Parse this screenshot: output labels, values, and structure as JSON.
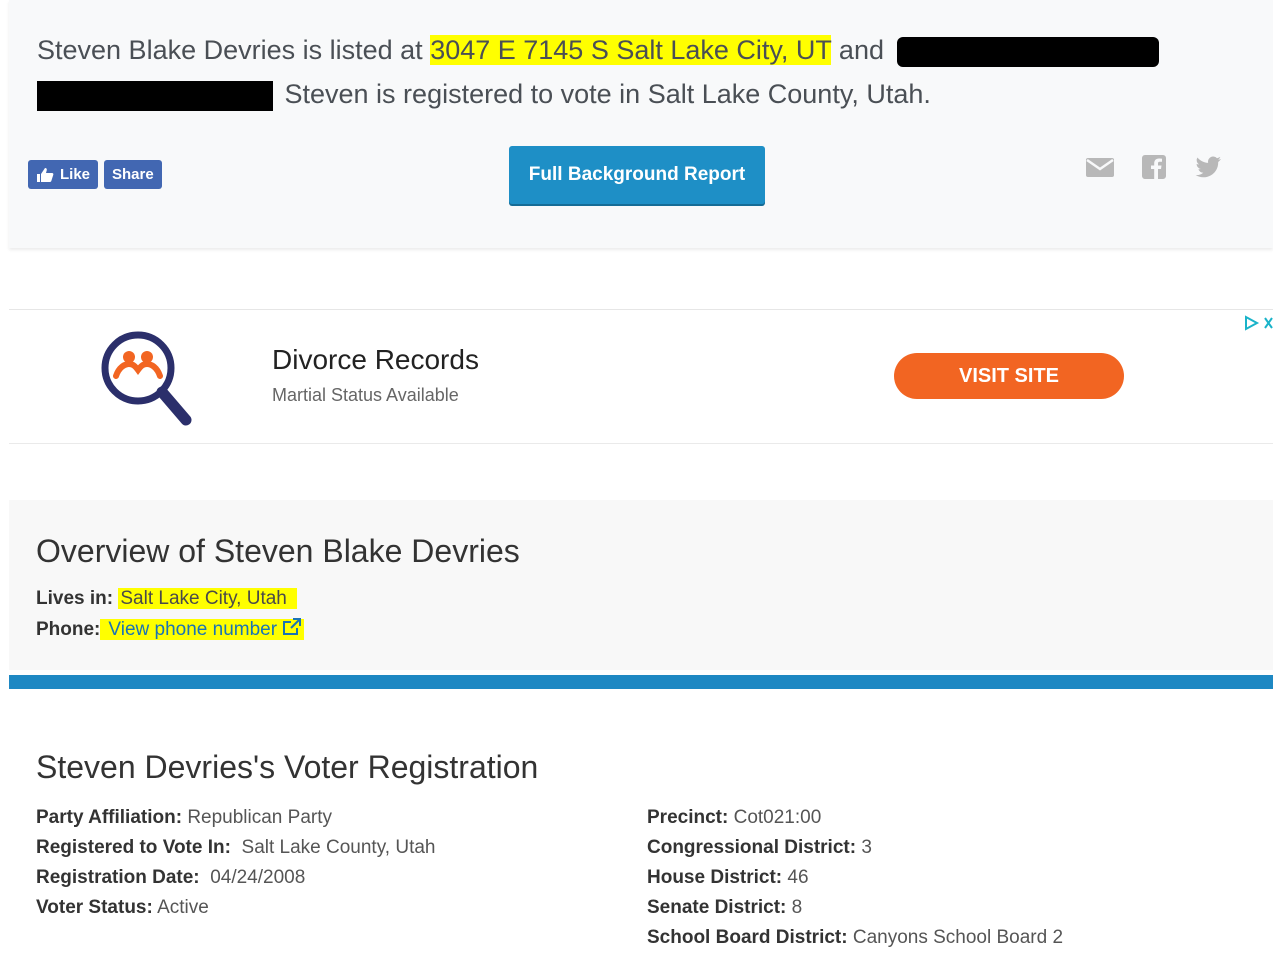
{
  "summary": {
    "prefix": "Steven Blake Devries is listed at ",
    "address": "3047 E 7145 S Salt Lake City, UT",
    "mid": " and ",
    "suffix": " Steven is registered to vote in Salt Lake County, Utah."
  },
  "social": {
    "like_label": "Like",
    "share_label": "Share"
  },
  "report_button": "Full Background Report",
  "share_icons": [
    "email-icon",
    "facebook-icon",
    "twitter-icon"
  ],
  "ad": {
    "title": "Divorce Records",
    "subtitle": "Martial Status Available",
    "button": "VISIT SITE"
  },
  "overview": {
    "title": "Overview of Steven Blake Devries",
    "lives_label": "Lives in:",
    "lives_value": "Salt Lake City, Utah",
    "phone_label": "Phone:",
    "phone_link": "View phone number"
  },
  "voter": {
    "title": "Steven Devries's Voter Registration",
    "left": [
      {
        "label": "Party Affiliation:",
        "value": "Republican Party"
      },
      {
        "label": "Registered to Vote In:",
        "value": "Salt Lake County, Utah"
      },
      {
        "label": "Registration Date:",
        "value": "04/24/2008"
      },
      {
        "label": "Voter Status:",
        "value": "Active"
      }
    ],
    "right": [
      {
        "label": "Precinct:",
        "value": "Cot021:00"
      },
      {
        "label": "Congressional District:",
        "value": "3"
      },
      {
        "label": "House District:",
        "value": "46"
      },
      {
        "label": "Senate District:",
        "value": "8"
      },
      {
        "label": "School Board District:",
        "value": "Canyons School Board 2"
      }
    ]
  },
  "colors": {
    "highlight": "#ffff00",
    "accent_blue": "#1e8fc6",
    "facebook": "#4267b2",
    "ad_button": "#f26522"
  }
}
